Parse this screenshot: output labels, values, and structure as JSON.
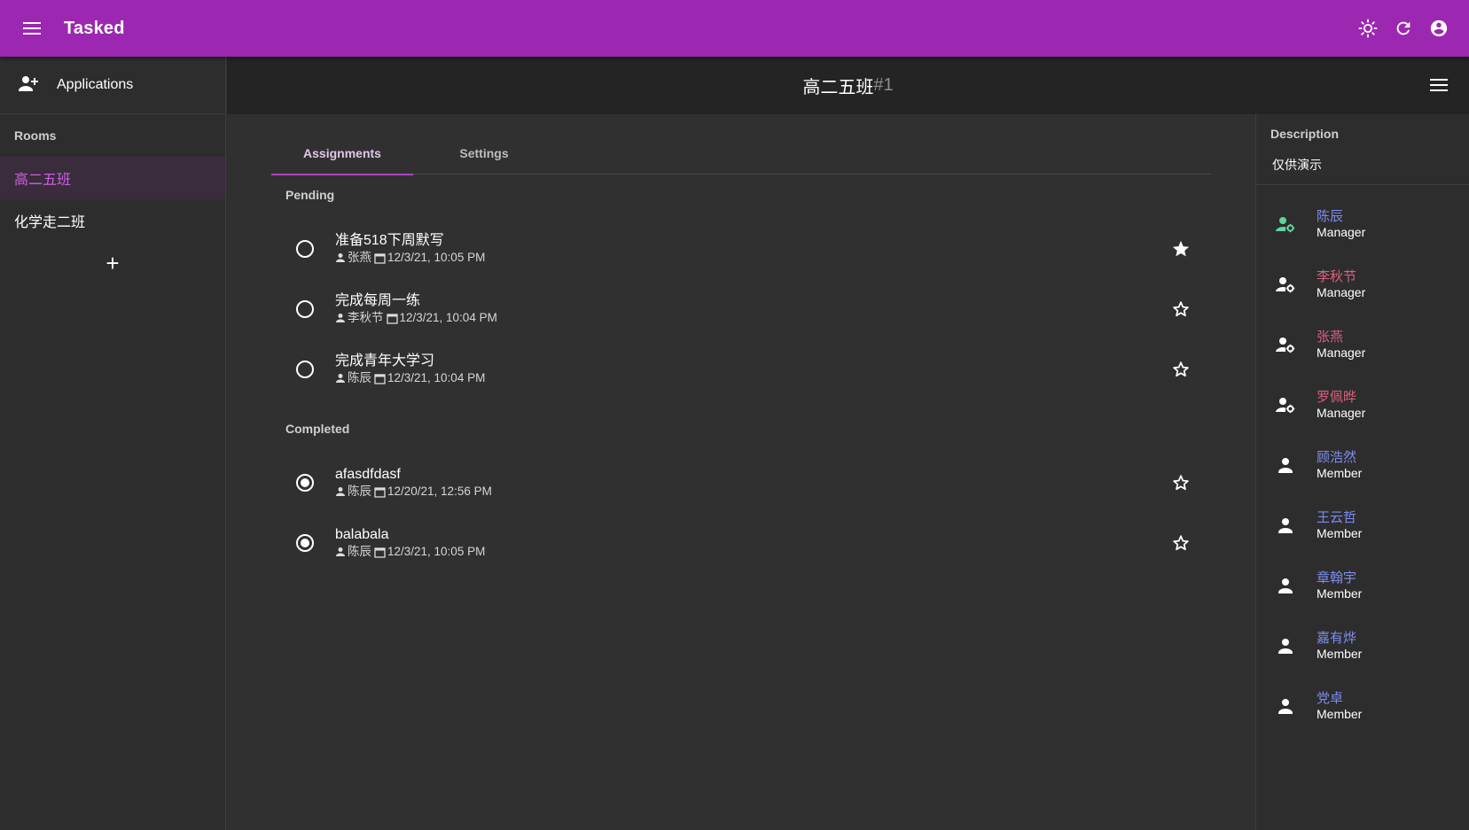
{
  "appbar": {
    "title": "Tasked",
    "icons": [
      "menu-icon",
      "brightness-icon",
      "refresh-icon",
      "account-circle-icon"
    ],
    "color": "#9c27b0"
  },
  "drawer": {
    "applications_label": "Applications",
    "rooms_header": "Rooms",
    "rooms": [
      {
        "name": "高二五班",
        "active": true
      },
      {
        "name": "化学走二班",
        "active": false
      }
    ],
    "add_label": "+"
  },
  "room": {
    "name": "高二五班",
    "id": "#1"
  },
  "tabs": [
    {
      "label": "Assignments",
      "active": true
    },
    {
      "label": "Settings",
      "active": false
    }
  ],
  "pending": {
    "header": "Pending",
    "tasks": [
      {
        "title": "准备518下周默写",
        "assignee": "张燕",
        "date": "12/3/21, 10:05 PM",
        "starred": true,
        "completed": false
      },
      {
        "title": "完成每周一练",
        "assignee": "李秋节",
        "date": "12/3/21, 10:04 PM",
        "starred": false,
        "completed": false
      },
      {
        "title": "完成青年大学习",
        "assignee": "陈辰",
        "date": "12/3/21, 10:04 PM",
        "starred": false,
        "completed": false
      }
    ]
  },
  "completed": {
    "header": "Completed",
    "tasks": [
      {
        "title": "afasdfdasf",
        "assignee": "陈辰",
        "date": "12/20/21, 12:56 PM",
        "starred": false,
        "completed": true
      },
      {
        "title": "balabala",
        "assignee": "陈辰",
        "date": "12/3/21, 10:05 PM",
        "starred": false,
        "completed": true
      }
    ]
  },
  "details": {
    "description_header": "Description",
    "description": "仅供演示",
    "members": [
      {
        "name": "陈辰",
        "role": "Manager",
        "color": "#7e8cf0",
        "icon": "manager-icon",
        "icon_color": "#5fd3a0"
      },
      {
        "name": "李秋节",
        "role": "Manager",
        "color": "#d9607f",
        "icon": "manager-icon",
        "icon_color": "#ffffff"
      },
      {
        "name": "张燕",
        "role": "Manager",
        "color": "#d9607f",
        "icon": "manager-icon",
        "icon_color": "#ffffff"
      },
      {
        "name": "罗佩晔",
        "role": "Manager",
        "color": "#d9607f",
        "icon": "manager-icon",
        "icon_color": "#ffffff"
      },
      {
        "name": "顾浩然",
        "role": "Member",
        "color": "#7e8cf0",
        "icon": "person-icon",
        "icon_color": "#ffffff"
      },
      {
        "name": "王云哲",
        "role": "Member",
        "color": "#7e8cf0",
        "icon": "person-icon",
        "icon_color": "#ffffff"
      },
      {
        "name": "章翰宇",
        "role": "Member",
        "color": "#7e8cf0",
        "icon": "person-icon",
        "icon_color": "#ffffff"
      },
      {
        "name": "嘉有烨",
        "role": "Member",
        "color": "#7e8cf0",
        "icon": "person-icon",
        "icon_color": "#ffffff"
      },
      {
        "name": "党卓",
        "role": "Member",
        "color": "#7e8cf0",
        "icon": "person-icon",
        "icon_color": "#ffffff"
      }
    ]
  }
}
